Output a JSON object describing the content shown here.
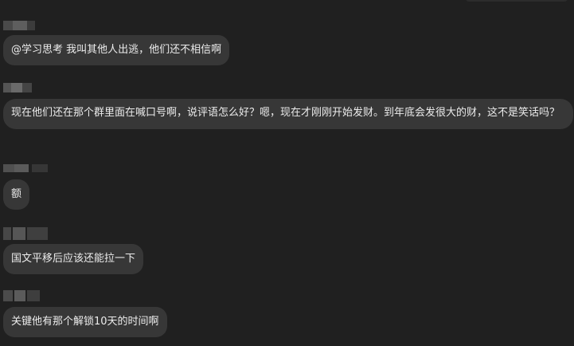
{
  "messages": [
    {
      "text": "@学习思考 我叫其他人出逃，他们还不相信啊"
    },
    {
      "text": "现在他们还在那个群里面在喊口号啊，说评语怎么好？嗯，现在才刚刚开始发财。到年底会发很大的财，这不是笑话吗？"
    },
    {
      "text": "额"
    },
    {
      "text": "国文平移后应该还能拉一下"
    },
    {
      "text": "关键他有那个解锁10天的时间啊"
    }
  ]
}
